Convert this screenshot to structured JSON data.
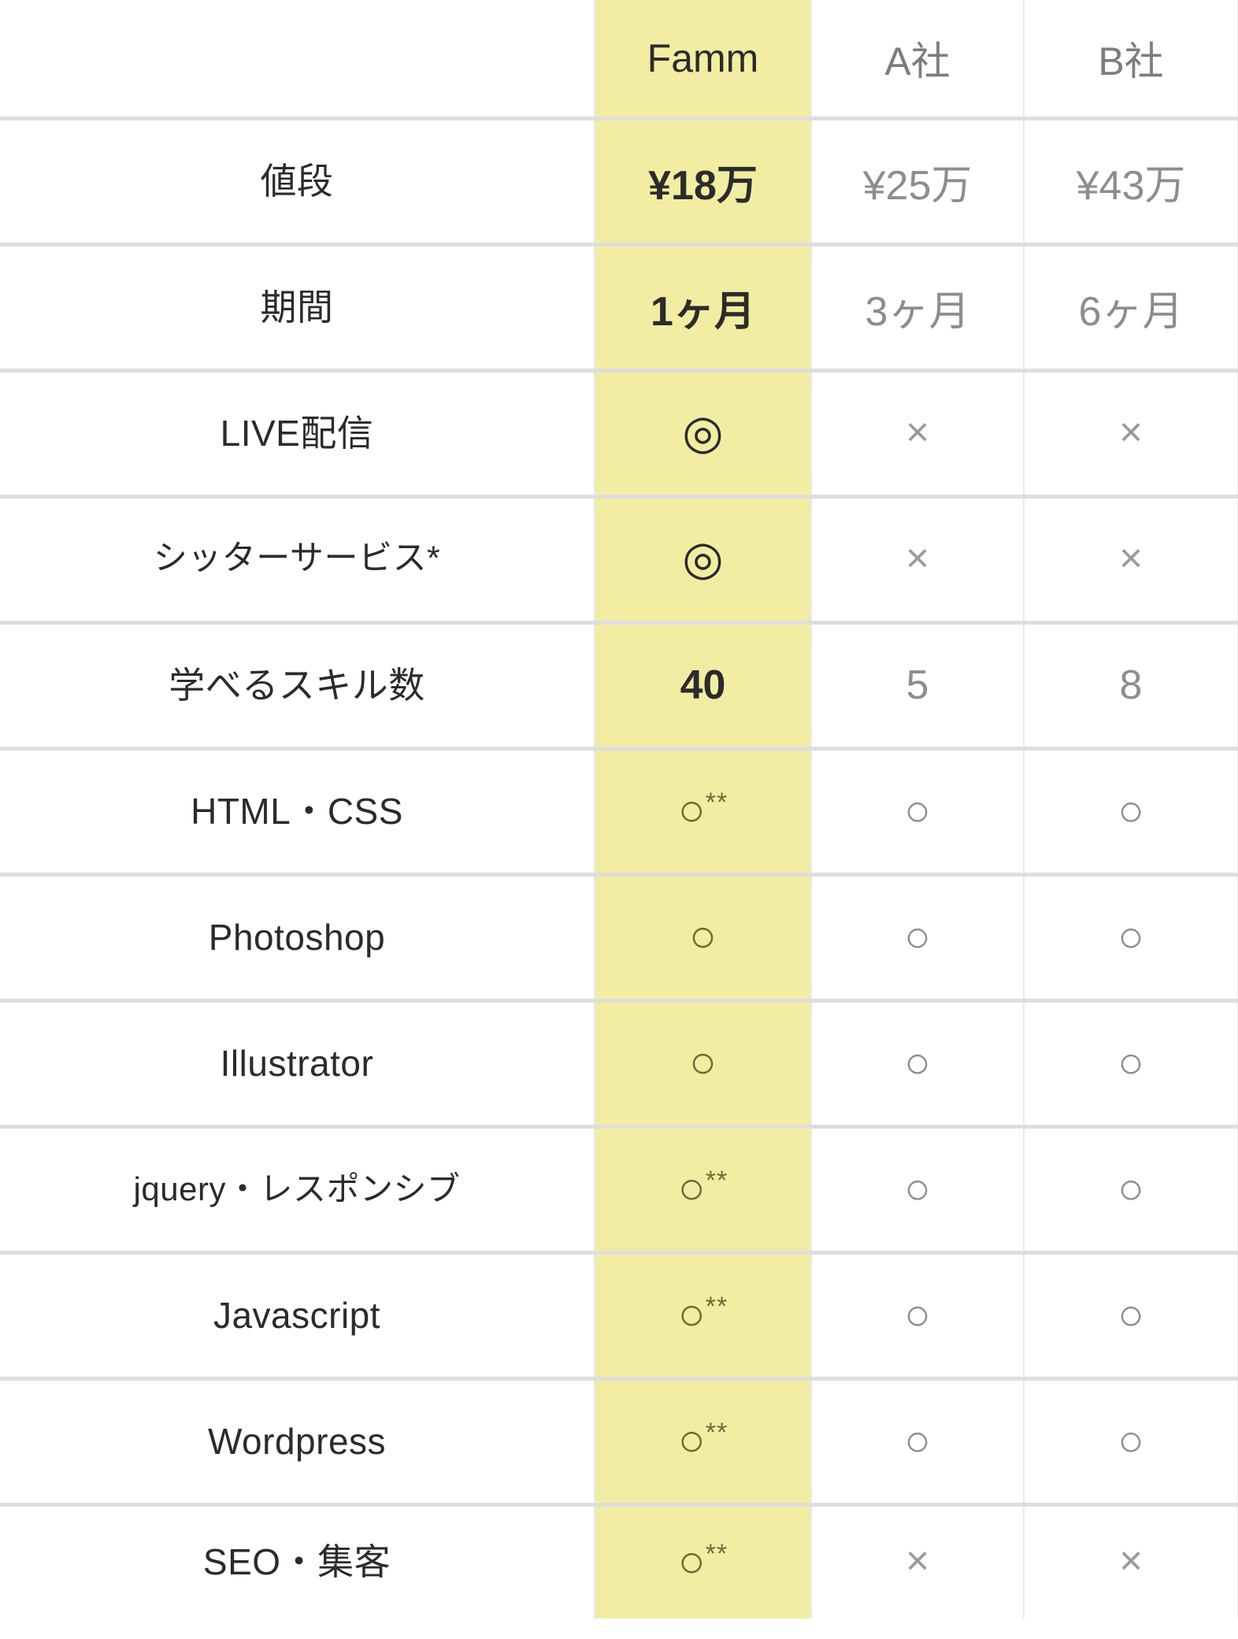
{
  "table": {
    "columns": [
      {
        "key": "label",
        "label": "",
        "highlight": false
      },
      {
        "key": "famm",
        "label": "Famm",
        "highlight": true
      },
      {
        "key": "a",
        "label": "A社",
        "highlight": false
      },
      {
        "key": "b",
        "label": "B社",
        "highlight": false
      }
    ],
    "rows": [
      {
        "label": "値段",
        "famm": "¥18万",
        "a": "¥25万",
        "b": "¥43万",
        "type": "text"
      },
      {
        "label": "期間",
        "famm": "1ヶ月",
        "a": "3ヶ月",
        "b": "6ヶ月",
        "type": "text"
      },
      {
        "label": "LIVE配信",
        "famm": "◎",
        "a": "×",
        "b": "×",
        "type": "mark"
      },
      {
        "label": "シッターサービス*",
        "famm": "◎",
        "a": "×",
        "b": "×",
        "type": "mark"
      },
      {
        "label": "学べるスキル数",
        "famm": "40",
        "a": "5",
        "b": "8",
        "type": "number"
      },
      {
        "label": "HTML・CSS",
        "famm": "○",
        "famm_note": "**",
        "a": "○",
        "b": "○",
        "type": "mark"
      },
      {
        "label": "Photoshop",
        "famm": "○",
        "famm_note": "",
        "a": "○",
        "b": "○",
        "type": "mark"
      },
      {
        "label": "Illustrator",
        "famm": "○",
        "famm_note": "",
        "a": "○",
        "b": "○",
        "type": "mark"
      },
      {
        "label": "jquery・レスポンシブ",
        "famm": "○",
        "famm_note": "**",
        "a": "○",
        "b": "○",
        "type": "mark"
      },
      {
        "label": "Javascript",
        "famm": "○",
        "famm_note": "**",
        "a": "○",
        "b": "○",
        "type": "mark"
      },
      {
        "label": "Wordpress",
        "famm": "○",
        "famm_note": "**",
        "a": "○",
        "b": "○",
        "type": "mark"
      },
      {
        "label": "SEO・集客",
        "famm": "○",
        "famm_note": "**",
        "a": "×",
        "b": "×",
        "type": "mark"
      }
    ]
  },
  "colors": {
    "highlight": "#f2eda3",
    "border": "#dedede",
    "border_light": "#e8e8e8",
    "text_strong": "#2b2b2b",
    "text_muted": "#8d8d8d"
  }
}
